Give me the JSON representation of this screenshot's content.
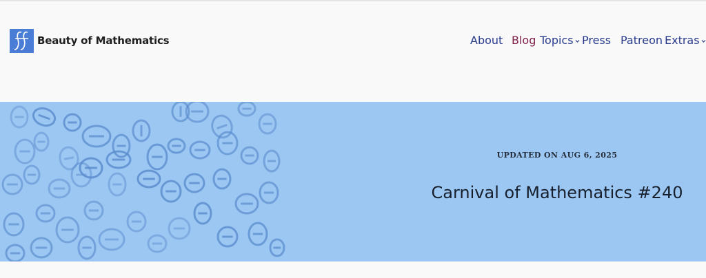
{
  "site": {
    "name": "Beauty of Mathematics",
    "logo_icon": "double-f-integral-logo-icon",
    "logo_color": "#4a7ed6"
  },
  "nav": {
    "items": [
      {
        "label": "About",
        "has_dropdown": false,
        "active": false
      },
      {
        "label": "Blog",
        "has_dropdown": false,
        "active": true
      },
      {
        "label": "Topics",
        "has_dropdown": true,
        "active": false
      },
      {
        "label": "Press",
        "has_dropdown": false,
        "active": false
      },
      {
        "label": "Patreon",
        "has_dropdown": false,
        "active": false
      },
      {
        "label": "Extras",
        "has_dropdown": true,
        "active": false
      }
    ],
    "link_color": "#283a8c",
    "active_color": "#7e1f4a"
  },
  "hero": {
    "updated": "UPDATED ON AUG 6, 2025",
    "title": "Carnival of Mathematics #240",
    "background_color": "#9dc7f3",
    "pattern_icon": "theta-symbols-pattern"
  }
}
